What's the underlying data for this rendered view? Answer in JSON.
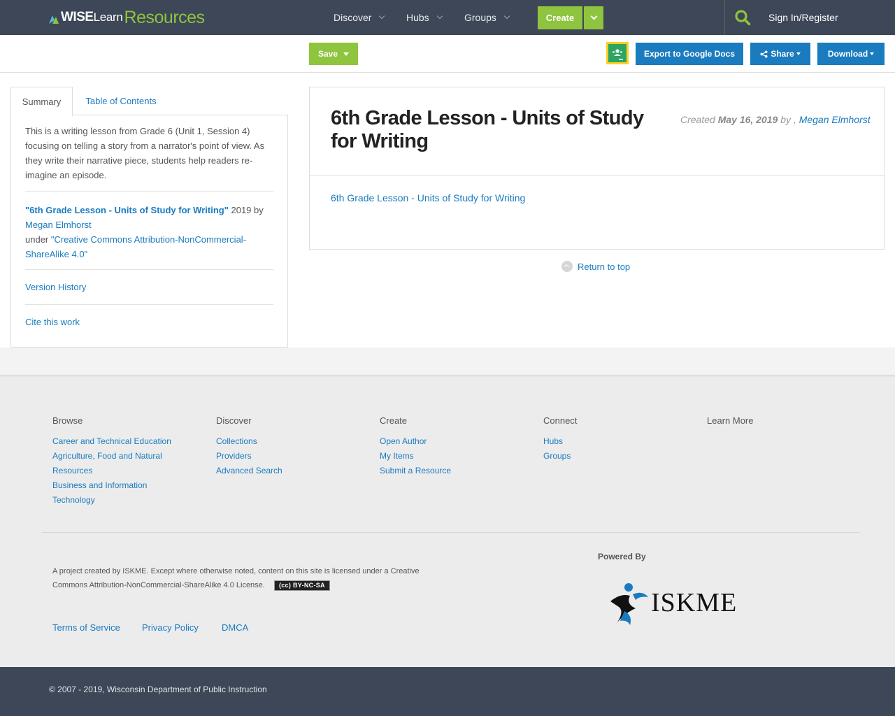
{
  "brand": {
    "part1": "WISE",
    "part2": "Learn",
    "part3": "Resources"
  },
  "nav": {
    "items": [
      {
        "label": "Discover"
      },
      {
        "label": "Hubs"
      },
      {
        "label": "Groups"
      }
    ],
    "create_label": "Create",
    "signin_label": "Sign In/Register"
  },
  "toolbar": {
    "save_label": "Save",
    "export_label": "Export to Google Docs",
    "share_label": "Share",
    "download_label": "Download"
  },
  "sidebar": {
    "tabs": [
      {
        "label": "Summary"
      },
      {
        "label": "Table of Contents"
      }
    ],
    "summary": "This is a writing lesson from Grade 6 (Unit 1, Session 4) focusing on telling a story from a narrator's point of view. As they write their narrative piece, students help readers re-imagine an episode.",
    "attribution": {
      "work_title": "\"6th Grade Lesson - Units of Study for Writing\"",
      "year_by": " 2019 by",
      "author": "Megan Elmhorst",
      "under": "under ",
      "license": "\"Creative Commons Attribution-NonCommercial-ShareAlike 4.0\""
    },
    "version_history": "Version History",
    "cite": "Cite this work"
  },
  "resource": {
    "title": "6th Grade Lesson - Units of Study for Writing",
    "created_label": "Created ",
    "created_date": "May 16, 2019",
    "by_label": " by , ",
    "author": "Megan Elmhorst",
    "link_text": "6th Grade Lesson - Units of Study for Writing"
  },
  "return_to_top": "Return to top",
  "footer": {
    "columns": [
      {
        "heading": "Browse",
        "links": [
          "Career and Technical Education",
          "Agriculture, Food and Natural Resources",
          "Business and Information Technology"
        ]
      },
      {
        "heading": "Discover",
        "links": [
          "Collections",
          "Providers",
          "Advanced Search"
        ]
      },
      {
        "heading": "Create",
        "links": [
          "Open Author",
          "My Items",
          "Submit a Resource"
        ]
      },
      {
        "heading": "Connect",
        "links": [
          "Hubs",
          "Groups"
        ]
      },
      {
        "heading": "Learn More",
        "links": []
      }
    ],
    "license_text": "A project created by ISKME. Except where otherwise noted, content on this site is licensed under a Creative Commons Attribution-NonCommercial-ShareAlike 4.0 License.",
    "cc_badge": "(cc) BY-NC-SA",
    "legal_links": [
      "Terms of Service",
      "Privacy Policy",
      "DMCA"
    ],
    "powered_by": "Powered By",
    "iskme_logo": "ISKME",
    "copyright": "© 2007 - 2019, Wisconsin Department of Public Instruction"
  },
  "colors": {
    "nav_bg": "#3d4757",
    "accent_green": "#8fc43e",
    "link_blue": "#1a7bbf",
    "classroom_yellow": "#ffcf24",
    "classroom_green": "#2ba560"
  },
  "icons": {
    "search": "search-icon",
    "classroom": "google-classroom-icon",
    "share": "share-icon",
    "return_top": "chevron-up-circle-icon"
  }
}
